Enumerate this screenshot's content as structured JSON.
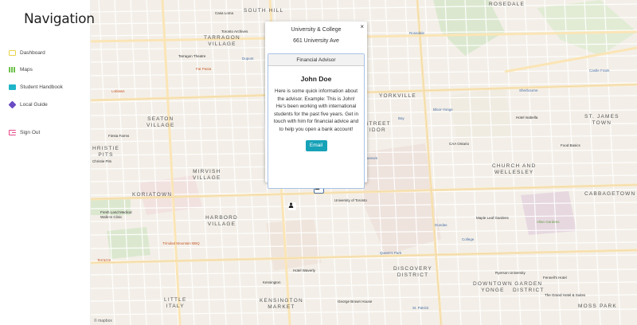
{
  "sidebar": {
    "title": "Navigation",
    "items": [
      {
        "label": "Dashboard",
        "icon": "dashboard-icon",
        "color": "#e8d34a"
      },
      {
        "label": "Maps",
        "icon": "map-icon",
        "color": "#6cc24a"
      },
      {
        "label": "Student Handbook",
        "icon": "book-icon",
        "color": "#1fb5c9"
      },
      {
        "label": "Local Guide",
        "icon": "compass-icon",
        "color": "#6a4bc4"
      },
      {
        "label": "Sign Out",
        "icon": "sign-out-icon",
        "color": "#e84a8a"
      }
    ]
  },
  "popup": {
    "place_name": "University & College",
    "address": "661 University Ave",
    "card": {
      "header": "Financial Advisor",
      "name": "John Doe",
      "description": "Here is some quick information about the advisor. Example: This is John! He's been working with international students for the past five years. Get in touch with him for financial advice and to help you open a bank account!",
      "button_label": "Email"
    },
    "close_symbol": "×"
  },
  "map": {
    "neighbourhoods": [
      {
        "text": "SOUTH HILL"
      },
      {
        "text": "ROSEDALE"
      },
      {
        "text": "TARRAGON\nVILLAGE"
      },
      {
        "text": "SEATON\nVILLAGE"
      },
      {
        "text": "YORKVILLE"
      },
      {
        "text": "ST. JAMES\nTOWN"
      },
      {
        "text": "KORIATOWN"
      },
      {
        "text": "HARBORD\nVILLAGE"
      },
      {
        "text": "MIRVISH\nVILLAGE"
      },
      {
        "text": "CHURCH AND\nWELLESLEY"
      },
      {
        "text": "CABBAGETOWN"
      },
      {
        "text": "DISCOVERY\nDISTRICT"
      },
      {
        "text": "DOWNTOWN\nYONGE"
      },
      {
        "text": "GARDEN\nDISTRICT"
      },
      {
        "text": "KENSINGTON\nMARKET"
      },
      {
        "text": "LITTLE\nITALY"
      },
      {
        "text": "MOSS PARK"
      },
      {
        "text": "HRISTIE\nPITS"
      },
      {
        "text": "STREET\nIDOR"
      }
    ],
    "pois": [
      {
        "text": "Casa Loma"
      },
      {
        "text": "Toronto Archives"
      },
      {
        "text": "Tarragon Theatre"
      },
      {
        "text": "Dupont"
      },
      {
        "text": "Rosedale"
      },
      {
        "text": "Castle Frank"
      },
      {
        "text": "Sherbourne"
      },
      {
        "text": "Bay"
      },
      {
        "text": "Bloor-Yonge"
      },
      {
        "text": "Museum"
      },
      {
        "text": "University of Toronto"
      },
      {
        "text": "Queen's Park"
      },
      {
        "text": "College"
      },
      {
        "text": "Maple Leaf Gardens"
      },
      {
        "text": "Allan Gardens"
      },
      {
        "text": "Ryerson University"
      },
      {
        "text": "Hotel Waverly"
      },
      {
        "text": "George Brown House"
      },
      {
        "text": "Fennell's Hotel"
      },
      {
        "text": "The Grand Hotel & Suites"
      },
      {
        "text": "Fiesta Farms"
      },
      {
        "text": "Loblaws"
      },
      {
        "text": "Fat Pasta"
      },
      {
        "text": "Christie Pits"
      },
      {
        "text": "Hotel Isabella"
      },
      {
        "text": "CAA Ontario"
      },
      {
        "text": "Food Basics"
      },
      {
        "text": "St. Patrick"
      },
      {
        "text": "Dundas"
      },
      {
        "text": "Fresh Land Medical\nWalk-In Clinic"
      },
      {
        "text": "Trinidad Mountain BBQ"
      },
      {
        "text": "Terrazze"
      },
      {
        "text": "Kensington"
      }
    ],
    "attribution": "© mapbox"
  }
}
